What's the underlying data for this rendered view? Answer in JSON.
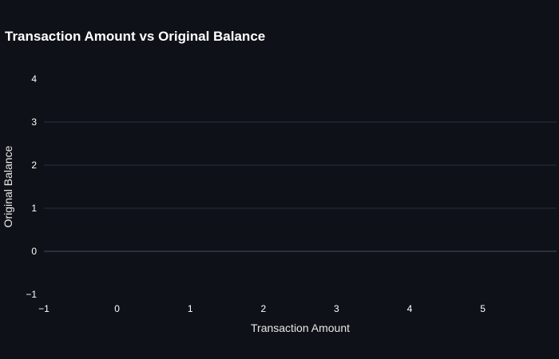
{
  "chart_data": {
    "type": "scatter",
    "title": "Transaction Amount vs Original Balance",
    "xlabel": "Transaction Amount",
    "ylabel": "Original Balance",
    "xlim": [
      -1,
      6
    ],
    "ylim": [
      -1,
      4
    ],
    "x_ticks": [
      -1,
      0,
      1,
      2,
      3,
      4,
      5
    ],
    "y_ticks": [
      -1,
      0,
      1,
      2,
      3,
      4
    ],
    "x": [],
    "y": [],
    "grid": "horizontal",
    "colors": {
      "background": "#0e1117",
      "grid": "#283040",
      "text": "#ffffff"
    }
  }
}
